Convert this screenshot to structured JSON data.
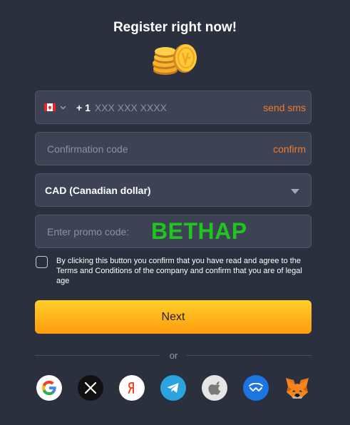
{
  "header": {
    "title": "Register right now!"
  },
  "phone": {
    "country_flag": "canada-flag-icon",
    "dial_code": "+ 1",
    "placeholder": "XXX XXX XXXX",
    "send_label": "send sms"
  },
  "confirmation": {
    "placeholder": "Confirmation code",
    "confirm_label": "confirm"
  },
  "currency": {
    "selected": "CAD (Canadian dollar)"
  },
  "promo": {
    "placeholder": "Enter promo code:",
    "overlay_code": "BETHAP"
  },
  "terms": {
    "checked": false,
    "text": "By clicking this button you confirm that you have read and agree to the Terms and Conditions of the company and confirm that you are of legal age"
  },
  "submit": {
    "label": "Next"
  },
  "divider": {
    "label": "or"
  },
  "social": [
    {
      "name": "google-icon"
    },
    {
      "name": "x-icon"
    },
    {
      "name": "yandex-icon"
    },
    {
      "name": "telegram-icon"
    },
    {
      "name": "apple-icon"
    },
    {
      "name": "walletconnect-icon"
    },
    {
      "name": "metamask-icon"
    }
  ],
  "colors": {
    "background": "#2b303f",
    "field": "#3d4354",
    "accent_link": "#ef7b2a",
    "button_top": "#ffcf2a",
    "button_bottom": "#ff9b0e",
    "promo_overlay": "#1ec61e"
  }
}
